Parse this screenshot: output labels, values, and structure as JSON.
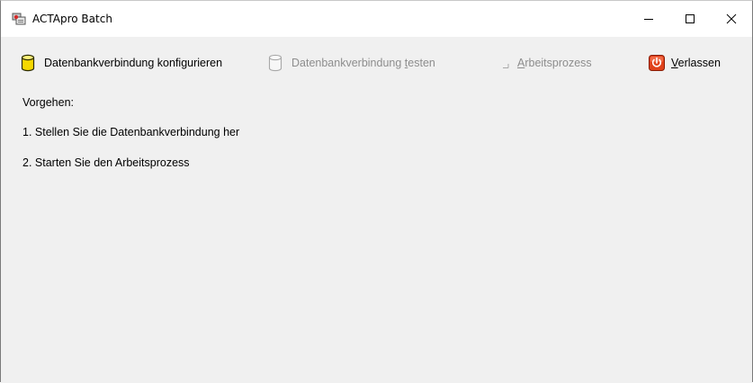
{
  "window": {
    "title": "ACTApro Batch",
    "icons": {
      "app": "batch-app-icon",
      "minimize": "minimize-icon",
      "maximize": "maximize-icon",
      "close": "close-icon"
    }
  },
  "toolbar": {
    "configure": {
      "label_pre": "Datenbankverbindung konfigurieren",
      "label_u": "",
      "label_post": "",
      "icon": "database-icon",
      "enabled": true
    },
    "test": {
      "label_pre": "Datenbankverbindung ",
      "label_u": "t",
      "label_post": "esten",
      "icon": "database-outline-icon",
      "enabled": false
    },
    "process": {
      "label_pre": "",
      "label_u": "A",
      "label_post": "rbeitsprozess",
      "icon": "process-icon",
      "enabled": false
    },
    "exit": {
      "label_pre": "",
      "label_u": "V",
      "label_post": "erlassen",
      "icon": "power-icon",
      "enabled": true
    }
  },
  "content": {
    "lines": [
      "Vorgehen:",
      "1. Stellen Sie die Datenbankverbindung her",
      "2. Starten Sie den Arbeitsprozess"
    ]
  },
  "colors": {
    "titlebar_bg": "#ffffff",
    "window_bg": "#f0f0f0",
    "database_fill": "#f5d800",
    "exit_red": "#e0421b",
    "disabled_text": "#8d8d8d"
  }
}
